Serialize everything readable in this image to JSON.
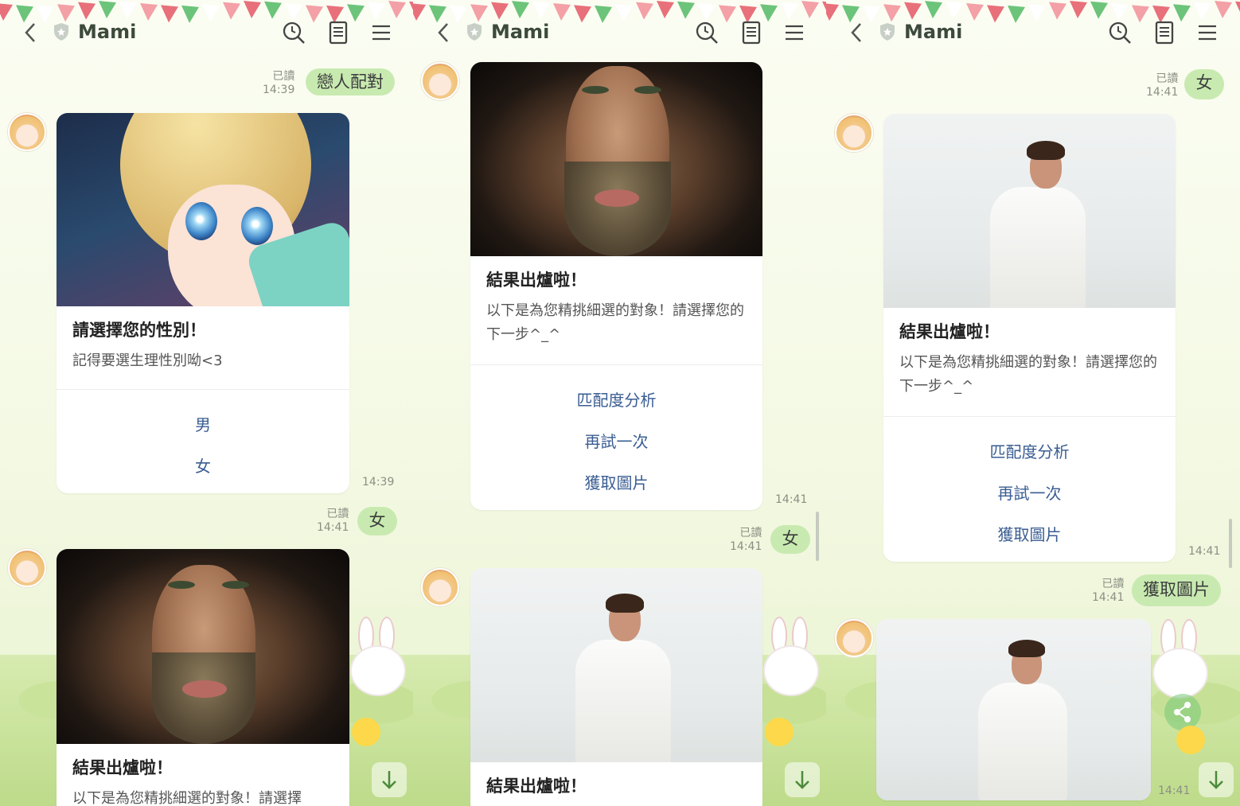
{
  "colors": {
    "bubble": "#c8eab0",
    "action_link": "#3a5d92",
    "background": "#f4f9e4"
  },
  "header": {
    "title": "Mami",
    "icons": [
      "chevron-left-icon",
      "shield-icon",
      "search-icon",
      "notes-icon",
      "menu-icon"
    ]
  },
  "panel1": {
    "msg1": {
      "text": "戀人配對",
      "read": "已讀",
      "time": "14:39"
    },
    "card1": {
      "title": "請選擇您的性別！",
      "text": "記得要選生理性別呦<3",
      "actions": [
        "男",
        "女"
      ],
      "time": "14:39"
    },
    "msg2": {
      "text": "女",
      "read": "已讀",
      "time": "14:41"
    },
    "card2": {
      "title": "結果出爐啦！",
      "text": "以下是為您精挑細選的對象！請選擇"
    }
  },
  "panel2": {
    "card1": {
      "title": "結果出爐啦！",
      "text": "以下是為您精挑細選的對象！請選擇您的下一步^_^",
      "actions": [
        "匹配度分析",
        "再試一次",
        "獲取圖片"
      ],
      "time": "14:41"
    },
    "msg1": {
      "text": "女",
      "read": "已讀",
      "time": "14:41"
    },
    "card2": {
      "title": "結果出爐啦！"
    }
  },
  "panel3": {
    "msg1": {
      "text": "女",
      "read": "已讀",
      "time": "14:41"
    },
    "card1": {
      "title": "結果出爐啦！",
      "text": "以下是為您精挑細選的對象！請選擇您的下一步^_^",
      "actions": [
        "匹配度分析",
        "再試一次",
        "獲取圖片"
      ],
      "time": "14:41"
    },
    "msg2": {
      "text": "獲取圖片",
      "read": "已讀",
      "time": "14:41"
    },
    "image_time": "14:41"
  }
}
